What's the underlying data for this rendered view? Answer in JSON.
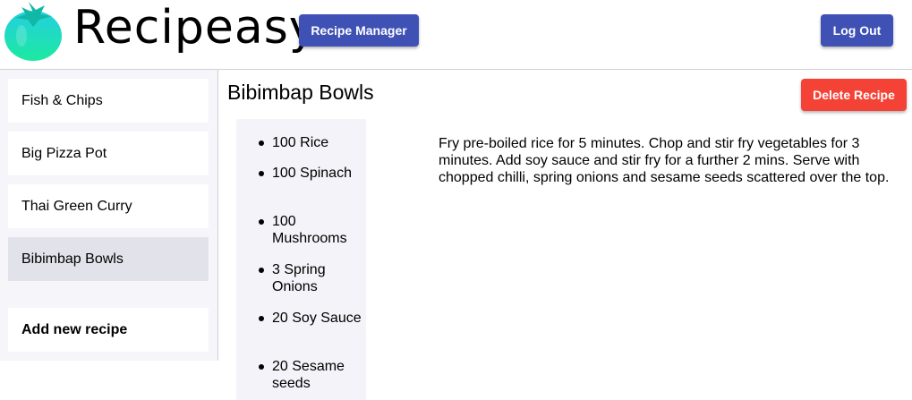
{
  "app": {
    "brand": "Recipeasy",
    "logo_icon": "tomato-icon",
    "colors": {
      "primary": "#3f51b5",
      "danger": "#f44336",
      "logo_gradient_top": "#23cfe0",
      "logo_gradient_bottom": "#1de9a0"
    }
  },
  "header": {
    "recipe_manager_label": "Recipe Manager",
    "logout_label": "Log Out"
  },
  "sidebar": {
    "items": [
      {
        "label": "Fish & Chips",
        "selected": false
      },
      {
        "label": "Big Pizza Pot",
        "selected": false
      },
      {
        "label": "Thai Green Curry",
        "selected": false
      },
      {
        "label": "Bibimbap Bowls",
        "selected": true
      }
    ],
    "add_label": "Add new recipe"
  },
  "recipe": {
    "title": "Bibimbap Bowls",
    "delete_label": "Delete Recipe",
    "ingredients": [
      "100 Rice",
      "100 Spinach",
      "100 Mushrooms",
      "3 Spring Onions",
      "20 Soy Sauce",
      "20 Sesame seeds"
    ],
    "method": "Fry pre-boiled rice for 5 minutes. Chop and stir fry vegetables for 3 minutes. Add soy sauce and stir fry for a further 2 mins. Serve with chopped chilli, spring onions and sesame seeds scattered over the top."
  }
}
